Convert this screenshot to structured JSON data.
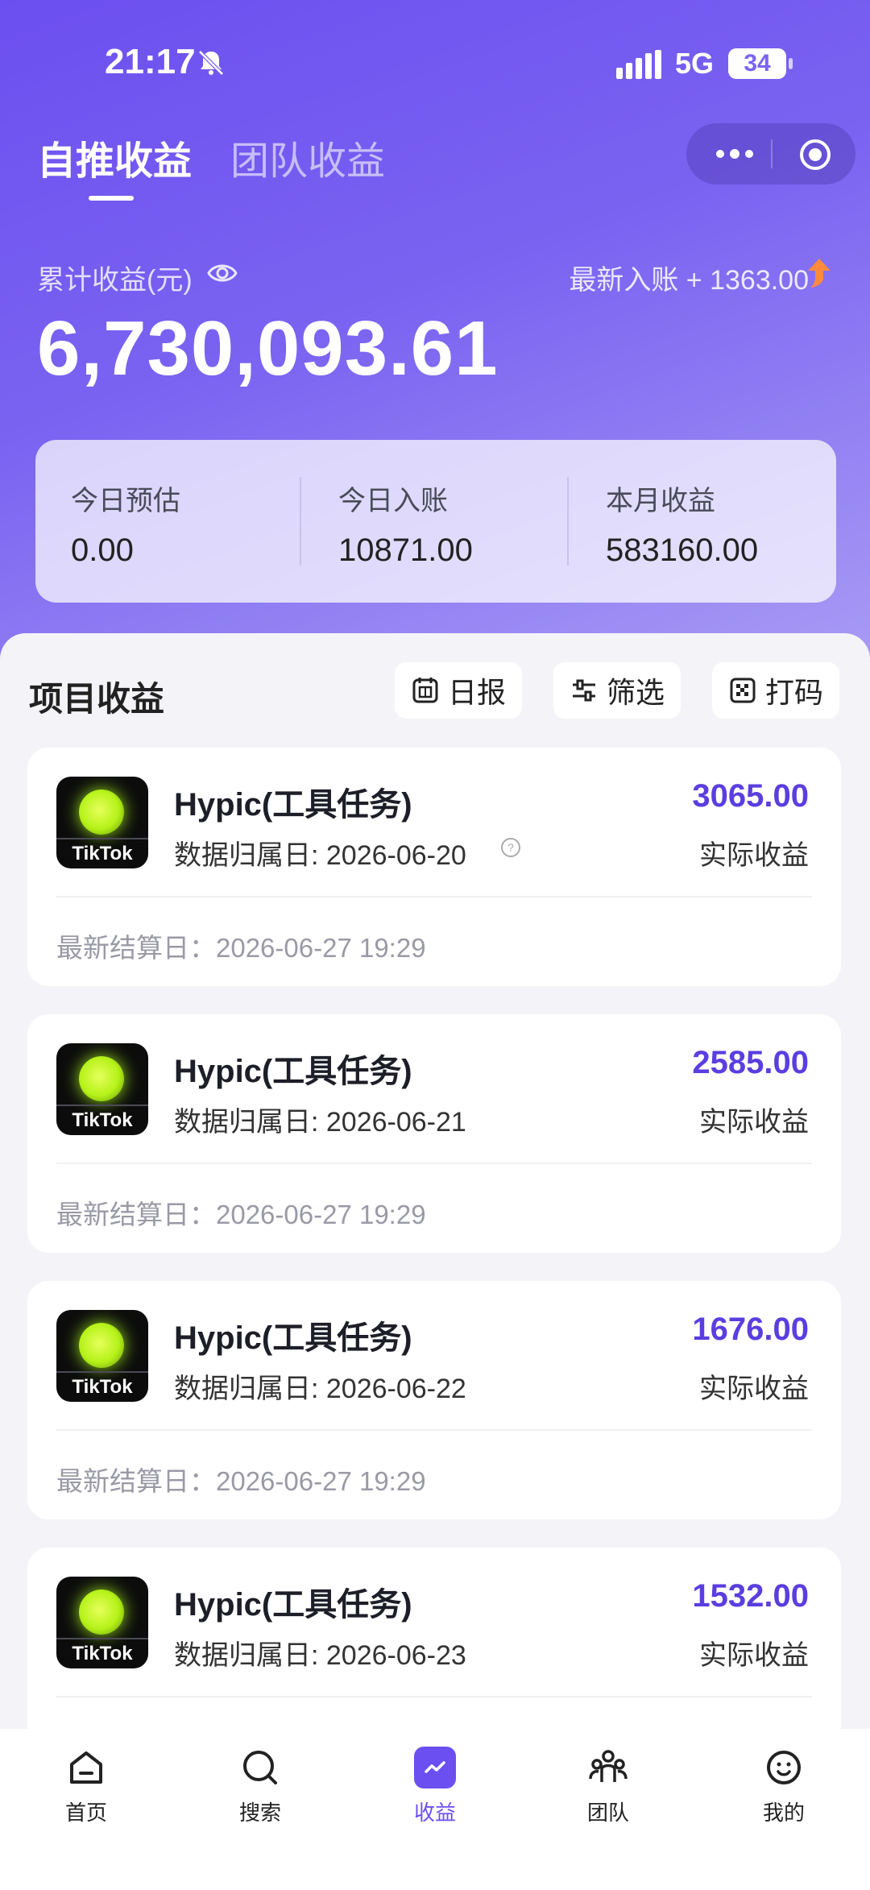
{
  "status_bar": {
    "time": "21:17",
    "network": "5G",
    "battery": "34"
  },
  "tabs": [
    {
      "label": "自推收益"
    },
    {
      "label": "团队收益"
    }
  ],
  "earnings": {
    "total_label": "累计收益(元)",
    "latest_label": "最新入账 + 1363.00",
    "total_amount": "6,730,093.61"
  },
  "summary": [
    {
      "label": "今日预估",
      "value": "0.00"
    },
    {
      "label": "今日入账",
      "value": "10871.00"
    },
    {
      "label": "本月收益",
      "value": "583160.00"
    }
  ],
  "section": {
    "title": "项目收益",
    "actions": [
      {
        "label": "日报"
      },
      {
        "label": "筛选"
      },
      {
        "label": "打码"
      }
    ]
  },
  "cards": [
    {
      "name": "Hypic(工具任务)",
      "brand": "TikTok",
      "date": "数据归属日: 2026-06-20",
      "amount": "3065.00",
      "amount_label": "实际收益",
      "settle": "最新结算日：2026-06-27 19:29"
    },
    {
      "name": "Hypic(工具任务)",
      "brand": "TikTok",
      "date": "数据归属日: 2026-06-21",
      "amount": "2585.00",
      "amount_label": "实际收益",
      "settle": "最新结算日：2026-06-27 19:29"
    },
    {
      "name": "Hypic(工具任务)",
      "brand": "TikTok",
      "date": "数据归属日: 2026-06-22",
      "amount": "1676.00",
      "amount_label": "实际收益",
      "settle": "最新结算日：2026-06-27 19:29"
    },
    {
      "name": "Hypic(工具任务)",
      "brand": "TikTok",
      "date": "数据归属日: 2026-06-23",
      "amount": "1532.00",
      "amount_label": "实际收益",
      "settle": ""
    }
  ],
  "nav": [
    {
      "label": "首页",
      "icon": "home-icon"
    },
    {
      "label": "搜索",
      "icon": "search-icon"
    },
    {
      "label": "收益",
      "icon": "earnings-icon"
    },
    {
      "label": "团队",
      "icon": "team-icon"
    },
    {
      "label": "我的",
      "icon": "profile-icon"
    }
  ],
  "colors": {
    "accent": "#6c4ff0",
    "amount": "#5a3ee0"
  }
}
